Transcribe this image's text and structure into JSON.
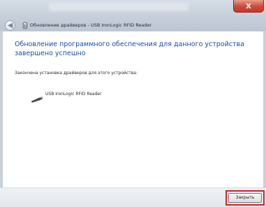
{
  "window": {
    "title": "Обновление драйверов - USB IronLogic RFID Reader",
    "close_glyph": "x"
  },
  "main": {
    "heading": "Обновление программного обеспечения для данного устройства завершено успешно",
    "subtext": "Закончена установка драйверов для этого устройства:",
    "device_name": "USB IronLogic RFID Reader"
  },
  "footer": {
    "close_label": "Закрыть"
  },
  "colors": {
    "heading": "#1a4ea0",
    "highlight": "#d8202a"
  },
  "icons": {
    "back": "back-arrow-icon",
    "device": "usb-device-icon",
    "close": "close-icon"
  }
}
